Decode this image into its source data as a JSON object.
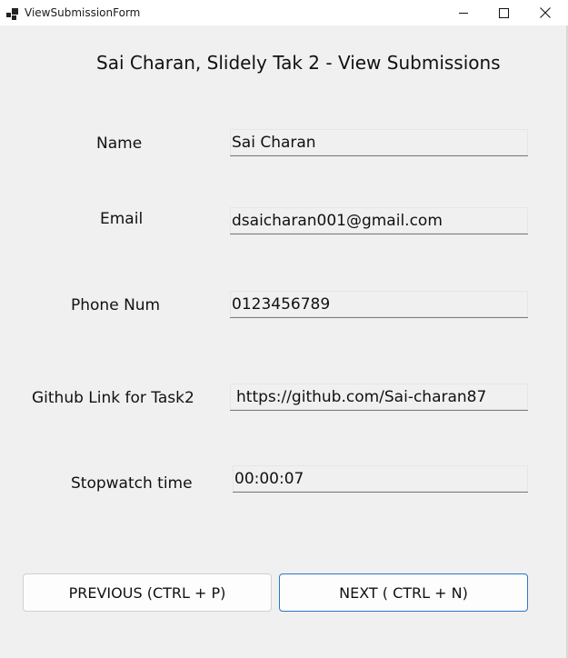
{
  "window": {
    "title": "ViewSubmissionForm",
    "app_icon": "form-window-icon",
    "controls": {
      "minimize_icon": "minimize-icon",
      "maximize_icon": "maximize-icon",
      "close_icon": "close-icon"
    }
  },
  "form": {
    "heading": "Sai Charan, Slidely Tak 2 - View Submissions",
    "fields": {
      "name": {
        "label": "Name",
        "value": "Sai Charan"
      },
      "email": {
        "label": "Email",
        "value": "dsaicharan001@gmail.com"
      },
      "phone": {
        "label": "Phone Num",
        "value": "0123456789"
      },
      "github": {
        "label": "Github Link for Task2",
        "value": "https://github.com/Sai-charan87"
      },
      "stopwatch": {
        "label": "Stopwatch time",
        "value": "00:00:07"
      }
    },
    "buttons": {
      "previous": "PREVIOUS (CTRL + P)",
      "next": "NEXT ( CTRL + N)"
    }
  },
  "colors": {
    "background": "#f0f0f0",
    "titlebar": "#ffffff",
    "next_button_border": "#2b78c6"
  }
}
